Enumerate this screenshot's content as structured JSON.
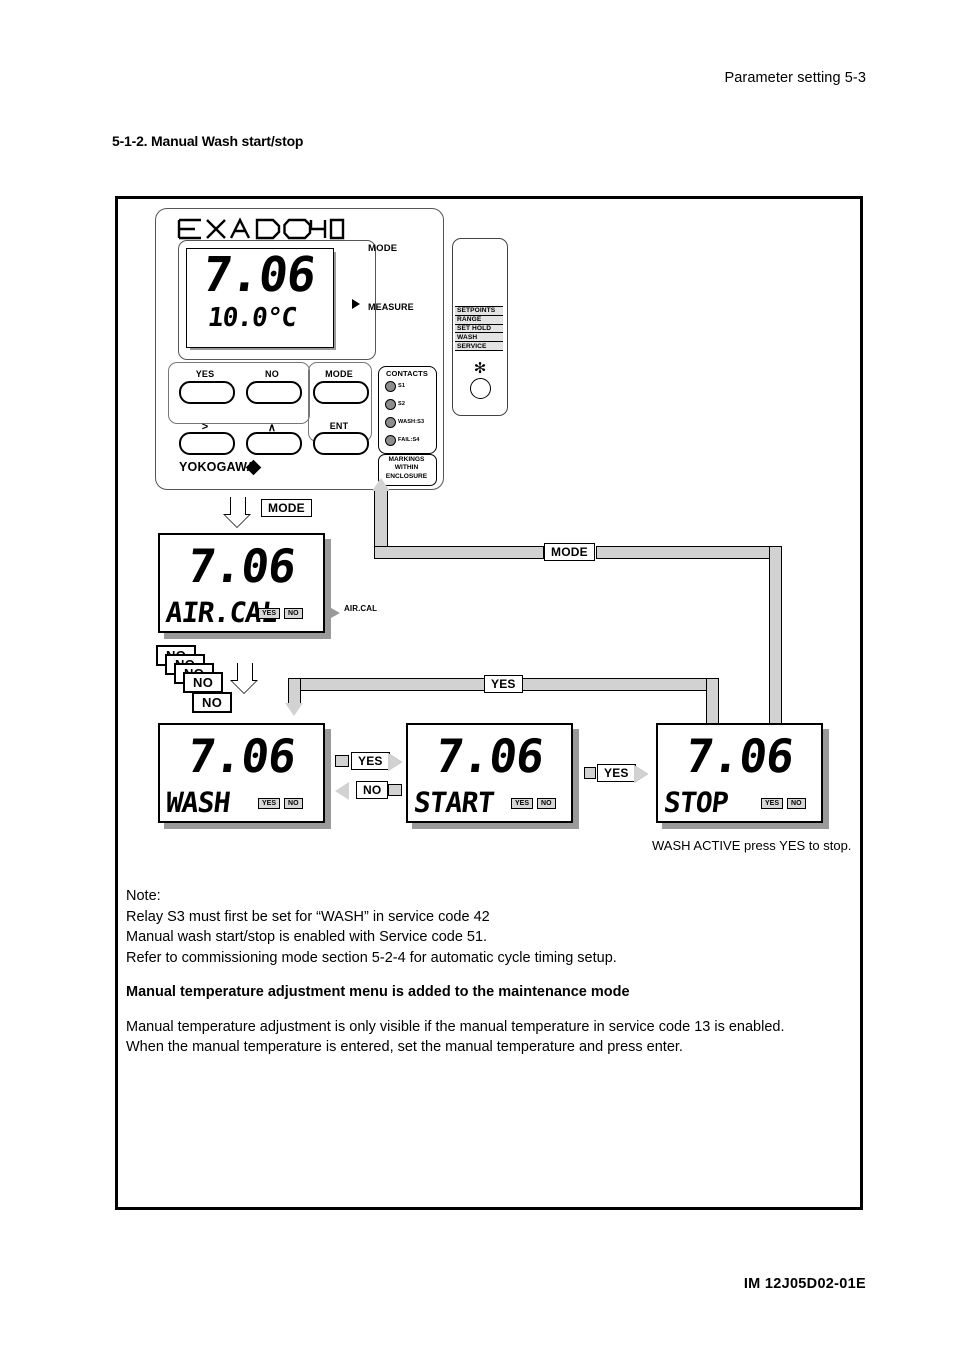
{
  "page": {
    "header": "Parameter setting 5-3",
    "section_title": "5-1-2. Manual Wash start/stop",
    "footer": "IM 12J05D02-01E"
  },
  "instrument": {
    "brand_logo": "EXA DO402",
    "brand_name": "YOKOGAWA",
    "lcd": {
      "value": "7.06",
      "temperature": "10.0°C",
      "mode_tag": "MODE",
      "measure_tag": "MEASURE"
    },
    "keys": [
      {
        "label": "YES"
      },
      {
        "label": "NO"
      },
      {
        "label": "MODE"
      },
      {
        "label": ">"
      },
      {
        "label": "∧"
      },
      {
        "label": "ENT"
      }
    ],
    "contacts": {
      "title": "CONTACTS",
      "leds": [
        {
          "label": "S1"
        },
        {
          "label": "S2"
        },
        {
          "label": "WASH:S3"
        },
        {
          "label": "FAIL:S4"
        }
      ]
    },
    "markings": "MARKINGS WITHIN ENCLOSURE",
    "markings_lines": [
      "MARKINGS",
      "WITHIN",
      "ENCLOSURE"
    ]
  },
  "side_plate": {
    "rows": [
      "SETPOINTS",
      "RANGE",
      "SET HOLD",
      "WASH",
      "SERVICE"
    ],
    "star_icon": "✻"
  },
  "flow": {
    "screens": {
      "aircal": {
        "value": "7.06",
        "label": "AIR.CAL",
        "yes": "YES",
        "no": "NO",
        "tag": "AIR.CAL"
      },
      "wash": {
        "value": "7.06",
        "label": "WASH",
        "yes": "YES",
        "no": "NO"
      },
      "start": {
        "value": "7.06",
        "label": "START",
        "yes": "YES",
        "no": "NO"
      },
      "stop": {
        "value": "7.06",
        "label": "STOP",
        "yes": "YES",
        "no": "NO"
      }
    },
    "labels": {
      "mode_down": "MODE",
      "mode_return": "MODE",
      "yes_top": "YES",
      "wash_to_start_yes": "YES",
      "start_to_wash_no": "NO",
      "start_to_stop_yes": "YES"
    },
    "no_stack": [
      "NO",
      "NO",
      "NO",
      "NO",
      "NO"
    ],
    "stop_caption": "WASH ACTIVE press YES to stop."
  },
  "notes": {
    "heading": "Note:",
    "lines": [
      "Relay S3 must first be set for “WASH” in service code 42",
      "Manual wash start/stop is enabled with Service code 51.",
      "Refer to commissioning mode section 5-2-4 for automatic cycle timing setup."
    ],
    "bold_heading": "Manual temperature adjustment menu is added to the maintenance mode",
    "tail_lines": [
      "Manual temperature adjustment is only visible if the manual temperature in service code 13 is enabled.",
      "When the manual temperature is entered, set the manual temperature and press enter."
    ]
  },
  "colors": {
    "flow_fill": "#d2d2d2",
    "lcd_shadow": "#9a9a9a",
    "led": "#8d8d8d"
  }
}
